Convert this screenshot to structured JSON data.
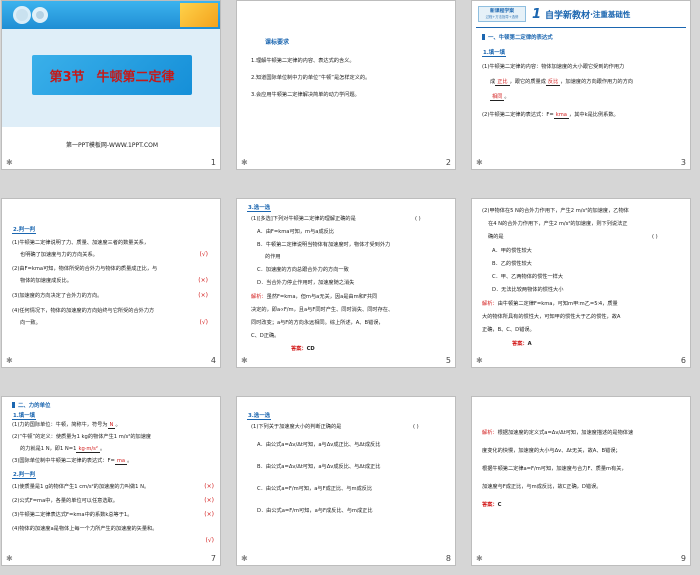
{
  "slides": [
    {
      "num": "1",
      "title_section": "第3节",
      "title_main": "牛顿第二定律",
      "footer": "第一PPT模板网-WWW.1PPT.COM"
    },
    {
      "num": "2",
      "heading": "课标要求",
      "lines": [
        "1.理解牛顿第二定律的内容、表达式的含义。",
        "2.知道国际单位制中力的单位“牛顿”是怎样定义的。",
        "3.会应用牛顿第二定律解决简单的动力学问题。"
      ]
    },
    {
      "num": "3",
      "banner_cap1": "新课程学案",
      "banner_cap2": "过程+方法指导+选修",
      "banner_no": "1",
      "banner_main": "自学新教材",
      "banner_tail": "·注重基础性",
      "section": "一、牛顿第二定律的表达式",
      "sub": "1.填一填",
      "l1": "(1)牛顿第二定律的内容：物体加速度的大小跟它受到的作用力",
      "l2a": "成",
      "l2b": "正比",
      "l2c": "，跟它的质量成",
      "l2d": "反比",
      "l2e": "，加速度的方向跟作用力的方向",
      "l3a": "",
      "l3b": "相同",
      "l3c": "。",
      "l4a": "(2)牛顿第二定律的表达式：F=",
      "l4b": "kma",
      "l4c": "，其中k是比例系数。"
    },
    {
      "num": "4",
      "sub": "2.判一判",
      "items": [
        {
          "text": [
            "(1)牛顿第二定律说明了力、质量、加速度三者的数量关系，",
            "也明确了加速度与力的方向关系。"
          ],
          "mark": "(√)"
        },
        {
          "text": [
            "(2)由F=kma可知，物体所受的合外力与物体的质量成正比，与",
            "物体的加速度成反比。"
          ],
          "mark": "(×)"
        },
        {
          "text": [
            "(3)加速度的方向决定了合外力的方向。"
          ],
          "mark": "(×)"
        },
        {
          "text": [
            "(4)任何情况下，物体的加速度的方向始终与它所受的合外力方",
            "向一致。"
          ],
          "mark": "(√)"
        }
      ]
    },
    {
      "num": "5",
      "sub": "3.选一选",
      "q": "(1)[多选]下列对牛顿第二定律的理解正确的是",
      "paren": "(    )",
      "opts": [
        "A．由F=kma可知，m与a成反比",
        "B．牛顿第二定律说明当物体有加速度时，物体才受到外力",
        "的作用",
        "C．加速度的方向总跟合外力的方向一致",
        "D．当合外力停止作用时，加速度随之消失"
      ],
      "jx": "解析：",
      "expl": [
        "虽然F=kma，但m与a无关，因a是由m和F共同",
        "决定的，即a∝F/m，且a与F同时产生、同时消失、同时存在、",
        "同时改变；a与F的方向永远相同。综上所述，A、B错误，",
        "C、D正确。"
      ],
      "ans_label": "答案：",
      "ans": "CD"
    },
    {
      "num": "6",
      "q": [
        "(2)甲物体在5 N的合外力作用下，产生2 m/s²的加速度，乙物体",
        "在4 N的合外力作用下，产生2 m/s²的加速度，则下列说法正",
        "确的是",
        "(    )"
      ],
      "opts": [
        "A．甲的惯性较大",
        "B．乙的惯性较大",
        "C．甲、乙两物体的惯性一样大",
        "D．无法比较两物体的惯性大小"
      ],
      "jx": "解析：",
      "expl": [
        "由牛顿第二定律F=kma，可知m甲∶m乙=5∶4，质量",
        "大的物体所具有的惯性大，可知甲的惯性大于乙的惯性，故A",
        "正确，B、C、D错误。"
      ],
      "ans_label": "答案：",
      "ans": "A"
    },
    {
      "num": "7",
      "section": "二、力的单位",
      "sub1": "1.填一填",
      "l1a": "(1)力的国际单位：牛顿，简称牛，符号为",
      "l1b": "N",
      "l1c": "。",
      "l2": "(2)“牛顿”的定义：使质量为1 kg的物体产生1 m/s²的加速度",
      "l3a": "的力就是1 N，即1 N=1",
      "l3b": "kg·m/s²",
      "l3c": "。",
      "l4a": "(3)国际单位制中牛顿第二定律的表达式：F=",
      "l4b": "ma",
      "l4c": "。",
      "sub2": "2.判一判",
      "items": [
        {
          "text": "(1)使质量是1 g的物体产生1 cm/s²的加速度的力叫做1 N。",
          "mark": "(×)"
        },
        {
          "text": "(2)公式F=ma中，各量的单位可以任意选取。",
          "mark": "(×)"
        },
        {
          "text": "(3)牛顿第二定律表达式F=kma中的系数k总等于1。",
          "mark": "(×)"
        },
        {
          "text": "(4)物体的加速度a是物体上每一个力所产生的加速度的矢量和。",
          "mark": "(√)"
        }
      ]
    },
    {
      "num": "8",
      "sub": "3.选一选",
      "q": "(1)下列关于加速度大小的判断正确的是",
      "paren": "(    )",
      "opts": [
        "A．由公式a=Δv/Δt可知，a与Δv成正比、与Δt成反比",
        "B．由公式a=Δv/Δt可知，a与Δv成反比、与Δt成正比",
        "C．由公式a=F/m可知，a与F成正比、与m成反比",
        "D．由公式a=F/m可知，a与F成反比、与m成正比"
      ]
    },
    {
      "num": "9",
      "jx": "解析：",
      "expl": [
        "根据加速度的定义式a=Δv/Δt可知，加速度描述的是物体速",
        "度变化的快慢，加速度的大小与Δv、Δt无关，故A、B错误；",
        "根据牛顿第二定律a=F/m可知，加速度与合力F、质量m有关，",
        "加速度与F成正比，与m成反比，故C正确，D错误。"
      ],
      "ans_label": "答案：",
      "ans": "C"
    }
  ],
  "colors": {
    "accent": "#1b66b0",
    "red": "#d21a1a",
    "slide1_bg": "#29a3e6",
    "slide1_title": "#c41a1a"
  }
}
